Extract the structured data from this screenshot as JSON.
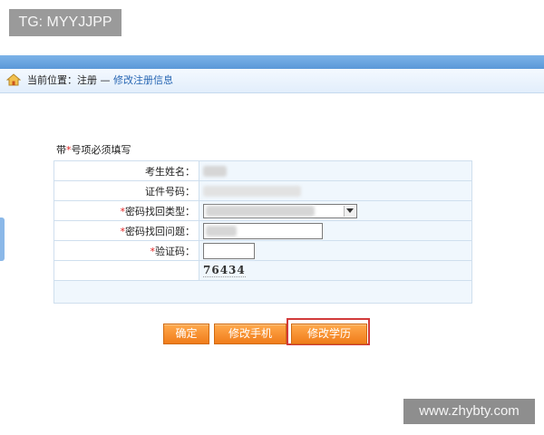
{
  "badge": {
    "text": "TG: MYYJJPP"
  },
  "breadcrumb": {
    "prefix": "当前位置：注册 — ",
    "current": "修改注册信息"
  },
  "form": {
    "required_note_prefix": "带",
    "required_star": "*",
    "required_note_suffix": "号项必须填写",
    "rows": [
      {
        "label": "考生姓名：",
        "required": false
      },
      {
        "label": "证件号码：",
        "required": false
      },
      {
        "label": "密码找回类型：",
        "required": true
      },
      {
        "label": "密码找回问题：",
        "required": true
      },
      {
        "label": "验证码：",
        "required": true
      }
    ],
    "captcha": "76434"
  },
  "buttons": {
    "confirm": "确定",
    "edit_phone": "修改手机",
    "edit_education": "修改学历"
  },
  "watermark": {
    "text": "www.zhybty.com"
  },
  "colors": {
    "accent_orange": "#f07c1a",
    "required_red": "#e02020",
    "link_blue": "#2766b3",
    "highlight_red": "#d23a3a"
  }
}
